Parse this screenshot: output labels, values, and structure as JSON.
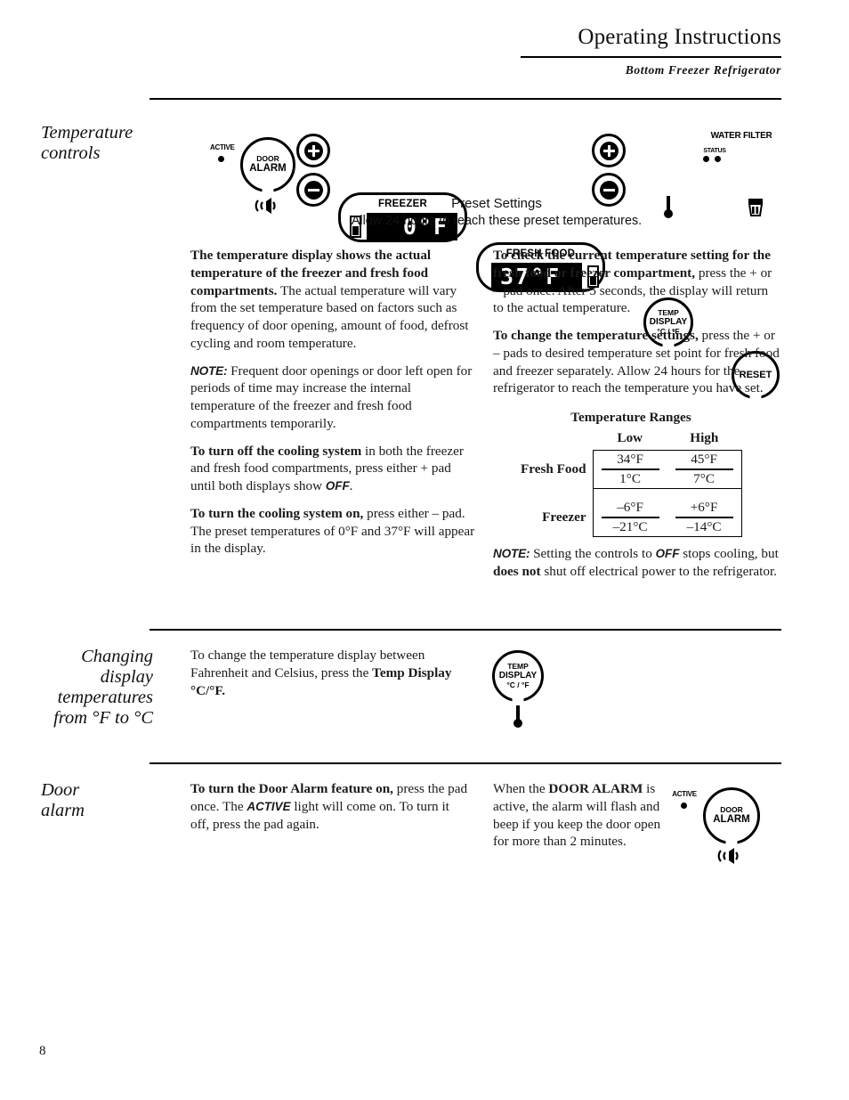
{
  "header": {
    "title": "Operating Instructions",
    "subtitle": "Bottom Freezer Refrigerator"
  },
  "page_number": "8",
  "sections": {
    "temperature_controls": {
      "heading": "Temperature\ncontrols",
      "panel": {
        "door_alarm": {
          "active_label": "ACTIVE",
          "button_line1": "DOOR",
          "button_line2": "ALARM",
          "sound_icon": "speaker-sound-icon"
        },
        "freezer_display": {
          "label": "FREEZER",
          "value": "0°F",
          "plus_label": "+",
          "minus_label": "–"
        },
        "fresh_food_display": {
          "label": "FRESH FOOD",
          "value": "37°F",
          "plus_label": "+",
          "minus_label": "–"
        },
        "temp_display_button": {
          "line1": "TEMP",
          "line2": "DISPLAY",
          "line3": "°C / °F",
          "icon": "thermometer-icon"
        },
        "water_filter": {
          "title": "WATER FILTER",
          "status_label": "STATUS",
          "button_label": "RESET",
          "icon": "water-filter-icon"
        }
      },
      "caption_line1": "Preset Settings",
      "caption_line2": "Allow 24 hours to reach these preset temperatures.",
      "left_column": {
        "p1_bold": "The temperature display shows the actual temperature of the freezer and fresh food compartments.",
        "p1_rest": " The actual temperature will vary from the set temperature based on factors such as frequency of door opening, amount of food, defrost cycling and room temperature.",
        "p2_note": "NOTE:",
        "p2_rest": " Frequent door openings or door left open for periods of time may increase the internal temperature of the freezer and fresh food compartments temporarily.",
        "p3_bold": "To turn off the cooling system",
        "p3_mid": " in both the freezer and fresh food compartments, press either + pad until both displays show ",
        "p3_off": "OFF",
        "p3_end": ".",
        "p4_bold": "To turn the cooling system on,",
        "p4_rest": " press either – pad. The preset temperatures of 0°F and 37°F will appear in the display."
      },
      "right_column": {
        "p1_bold": "To check the current temperature setting for the fresh food or freezer compartment,",
        "p1_rest": " press the + or – pad once. After 5 seconds, the display will return to the actual temperature.",
        "p2_bold": "To change the temperature settings,",
        "p2_rest": " press the + or – pads to desired temperature set point for fresh food and freezer separately. Allow 24 hours for the refrigerator to reach the temperature you have set.",
        "note_label": "NOTE:",
        "note_part1": " Setting the controls to ",
        "note_off": "OFF",
        "note_part2": " stops cooling, but ",
        "note_bold": "does not",
        "note_part3": " shut off electrical power to the refrigerator."
      },
      "temperature_ranges": {
        "title": "Temperature Ranges",
        "col_headers": [
          "Low",
          "High"
        ],
        "rows": [
          {
            "label": "Fresh Food",
            "low_f": "34°F",
            "low_c": "1°C",
            "high_f": "45°F",
            "high_c": "7°C"
          },
          {
            "label": "Freezer",
            "low_f": "–6°F",
            "low_c": "–21°C",
            "high_f": "+6°F",
            "high_c": "–14°C"
          }
        ]
      }
    },
    "changing_display": {
      "heading": "Changing\ndisplay\ntemperatures\nfrom °F to °C",
      "body_part1": "To change the temperature display between Fahrenheit and Celsius, press the ",
      "body_bold": "Temp Display °C/°F.",
      "icon": {
        "line1": "TEMP",
        "line2": "DISPLAY",
        "line3": "°C / °F",
        "thermometer": "thermometer-icon"
      }
    },
    "door_alarm": {
      "heading": "Door\nalarm",
      "left_bold": "To turn the Door Alarm feature on,",
      "left_part1": " press the pad once. The ",
      "left_active": "ACTIVE",
      "left_part2": " light will come on. To turn it off, press the pad again.",
      "right_part1": "When the ",
      "right_bold": "DOOR ALARM",
      "right_part2": " is active, the alarm will flash and beep if you keep the door open for more than 2 minutes.",
      "icon": {
        "active_label": "ACTIVE",
        "line1": "DOOR",
        "line2": "ALARM",
        "sound_icon": "speaker-sound-icon"
      }
    }
  }
}
